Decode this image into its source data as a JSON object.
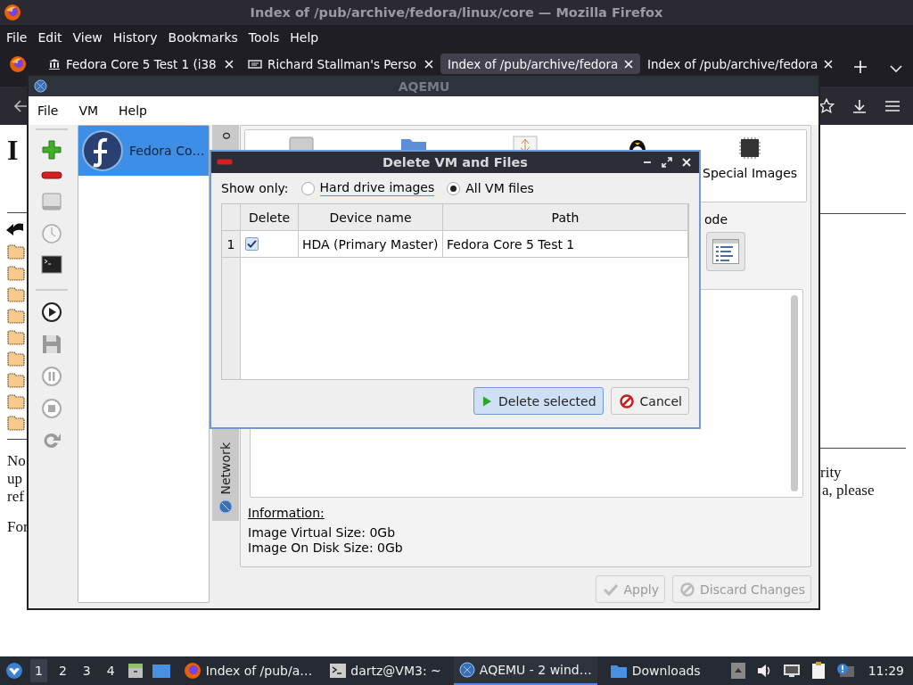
{
  "firefox": {
    "title": "Index of /pub/archive/fedora/linux/core — Mozilla Firefox",
    "menu": [
      "File",
      "Edit",
      "View",
      "History",
      "Bookmarks",
      "Tools",
      "Help"
    ],
    "tabs": [
      {
        "label": "Fedora Core 5 Test 1 (i38",
        "kind": "archive",
        "selected": false
      },
      {
        "label": "Richard Stallman's Perso",
        "kind": "site",
        "selected": false
      },
      {
        "label": "Index of /pub/archive/fedora",
        "kind": "plain",
        "selected": true
      },
      {
        "label": "Index of /pub/archive/fedora",
        "kind": "plain",
        "selected": false
      }
    ],
    "page": {
      "heading": "I",
      "left_lines": [
        "No",
        "up",
        "ref"
      ],
      "left_footer": "For",
      "right_lines": [
        "rity",
        "a, please"
      ]
    }
  },
  "aqemu": {
    "title": "AQEMU",
    "menu": [
      "File",
      "VM",
      "Help"
    ],
    "vm_list": [
      {
        "name": "Fedora Co…",
        "selected": true
      }
    ],
    "side_tabs": [
      {
        "label": "o",
        "kind": "text"
      },
      {
        "label": "Network",
        "kind": "network"
      }
    ],
    "media_label": "Special Images",
    "mode_label": "ode",
    "information": {
      "title": "Information:",
      "lines": [
        "Image Virtual Size: 0Gb",
        "Image On Disk Size: 0Gb"
      ]
    },
    "buttons": [
      {
        "label": "Apply",
        "kind": "apply",
        "disabled": true
      },
      {
        "label": "Discard Changes",
        "kind": "discard",
        "disabled": true
      }
    ]
  },
  "dialog": {
    "title": "Delete VM and Files",
    "filter_label": "Show only:",
    "filter_options": [
      {
        "label": "Hard drive images",
        "selected": false
      },
      {
        "label": "All VM files",
        "selected": true
      }
    ],
    "table": {
      "columns": [
        "Delete",
        "Device name",
        "Path"
      ],
      "rows": [
        {
          "number": "1",
          "delete": true,
          "device": "HDA (Primary Master)",
          "path": "Fedora Core 5 Test 1"
        }
      ]
    },
    "buttons": [
      {
        "label": "Delete selected",
        "kind": "delete",
        "focused": true
      },
      {
        "label": "Cancel",
        "kind": "cancel",
        "focused": false
      }
    ]
  },
  "taskbar": {
    "workspaces": [
      {
        "label": "1",
        "selected": true
      },
      {
        "label": "2",
        "selected": false
      },
      {
        "label": "3",
        "selected": false
      },
      {
        "label": "4",
        "selected": false
      }
    ],
    "tasks": [
      {
        "label": "Index of /pub/a…",
        "kind": "browser",
        "selected": false
      },
      {
        "label": "dartz@VM3: ~",
        "kind": "terminal",
        "selected": false
      },
      {
        "label": "AQEMU - 2 wind…",
        "kind": "aqemu",
        "selected": true
      },
      {
        "label": "Downloads",
        "kind": "folder",
        "selected": false
      }
    ],
    "clock": "11:29"
  }
}
